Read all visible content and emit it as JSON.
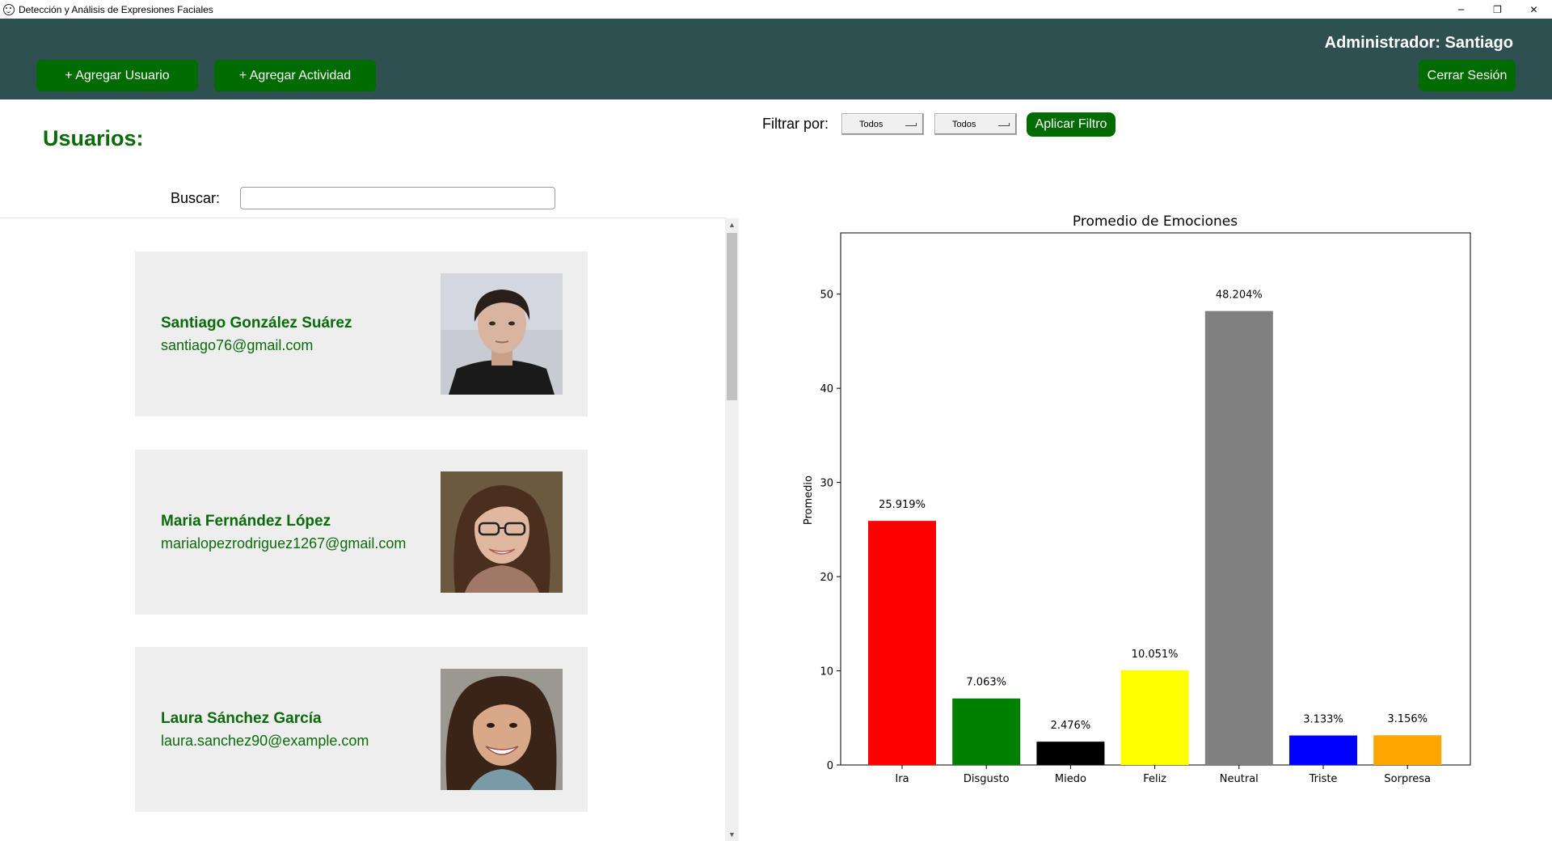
{
  "window": {
    "title": "Detección y Análisis de Expresiones Faciales",
    "controls": {
      "minimize": "─",
      "restore": "❐",
      "close": "✕"
    }
  },
  "header": {
    "add_user_label": "+ Agregar Usuario",
    "add_activity_label": "+ Agregar Actividad",
    "admin_label": "Administrador: Santiago",
    "logout_label": "Cerrar Sesión"
  },
  "users_panel": {
    "title": "Usuarios:",
    "search_label": "Buscar:",
    "search_value": "",
    "users": [
      {
        "name": "Santiago González Suárez",
        "email": "santiago76@gmail.com"
      },
      {
        "name": "Maria Fernández López",
        "email": "marialopezrodriguez1267@gmail.com"
      },
      {
        "name": "Laura Sánchez García",
        "email": "laura.sanchez90@example.com"
      }
    ]
  },
  "filter": {
    "label": "Filtrar por:",
    "select_1": "Todos",
    "select_2": "Todos",
    "apply_label": "Aplicar Filtro"
  },
  "colors": {
    "header_bg": "#2f5050",
    "button_green": "#006b00",
    "text_green": "#0b6b0b",
    "card_bg": "#eeeeee"
  },
  "chart_data": {
    "type": "bar",
    "title": "Promedio de Emociones",
    "xlabel": "",
    "ylabel": "Promedio",
    "categories": [
      "Ira",
      "Disgusto",
      "Miedo",
      "Feliz",
      "Neutral",
      "Triste",
      "Sorpresa"
    ],
    "values": [
      25.919,
      7.063,
      2.476,
      10.051,
      48.204,
      3.133,
      3.156
    ],
    "data_labels": [
      "25.919%",
      "7.063%",
      "2.476%",
      "10.051%",
      "48.204%",
      "3.133%",
      "3.156%"
    ],
    "colors": [
      "#ff0000",
      "#008000",
      "#000000",
      "#ffff00",
      "#808080",
      "#0000ff",
      "#ffa500"
    ],
    "ylim": [
      0,
      56.5
    ],
    "yticks": [
      0,
      10,
      20,
      30,
      40,
      50
    ],
    "grid": false,
    "legend": "none"
  }
}
